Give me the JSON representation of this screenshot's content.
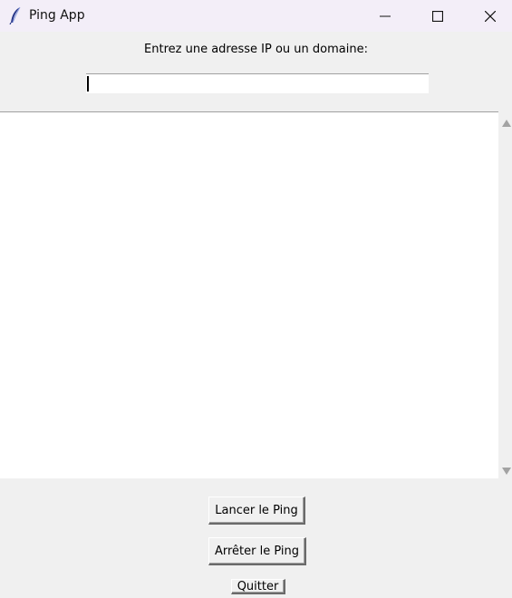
{
  "window": {
    "title": "Ping App",
    "icon": "feather-icon",
    "controls": [
      "minimize-icon",
      "maximize-icon",
      "close-icon"
    ]
  },
  "form": {
    "prompt_label": "Entrez une adresse IP ou un domaine:",
    "address_value": ""
  },
  "output": {
    "text": ""
  },
  "buttons": {
    "start_label": "Lancer le Ping",
    "stop_label": "Arrêter le Ping",
    "quit_label": "Quitter"
  }
}
